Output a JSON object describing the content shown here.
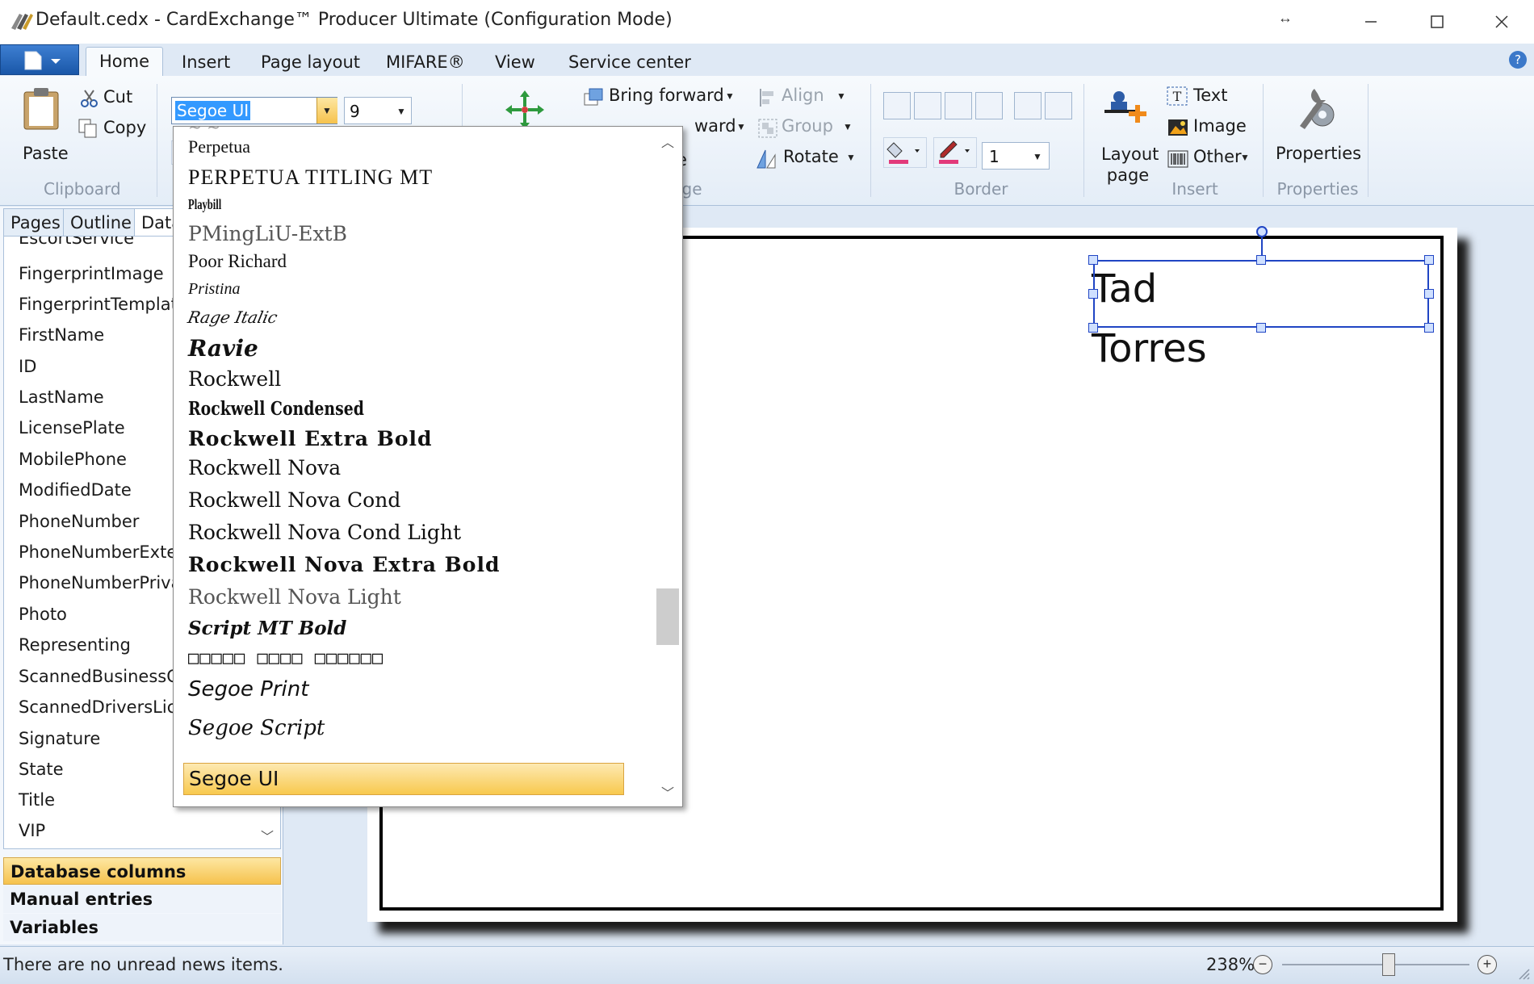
{
  "window": {
    "title": "Default.cedx - CardExchange™ Producer Ultimate (Configuration Mode)",
    "resize_glyph": "↔"
  },
  "ribbon_tabs": [
    "Home",
    "Insert",
    "Page layout",
    "MIFARE®",
    "View",
    "Service center"
  ],
  "ribbon": {
    "clipboard": {
      "paste": "Paste",
      "cut": "Cut",
      "copy": "Copy",
      "group": "Clipboard"
    },
    "font": {
      "family": "Segoe UI",
      "size": "9"
    },
    "arrange": {
      "bring_forward": "Bring forward",
      "send_backward_partial": "ward",
      "arrange_partial_e": "e",
      "group_partial_ge": "ge",
      "align": "Align",
      "group": "Group",
      "rotate": "Rotate"
    },
    "border": {
      "group": "Border",
      "line_width": "1"
    },
    "insert": {
      "layout_page": "Layout page",
      "text": "Text",
      "image": "Image",
      "other": "Other",
      "group": "Insert"
    },
    "properties": {
      "label": "Properties",
      "group": "Properties"
    }
  },
  "left_pane": {
    "tabs": [
      "Pages",
      "Outline",
      "Data"
    ],
    "fields": [
      "EscortService",
      "FingerprintImage",
      "FingerprintTemplate",
      "FirstName",
      "ID",
      "LastName",
      "LicensePlate",
      "MobilePhone",
      "ModifiedDate",
      "PhoneNumber",
      "PhoneNumberExtens",
      "PhoneNumberPrivate",
      "Photo",
      "Representing",
      "ScannedBusinessCard",
      "ScannedDriversLicen",
      "Signature",
      "State",
      "Title",
      "VIP"
    ],
    "sections": [
      "Database columns",
      "Manual entries",
      "Variables"
    ]
  },
  "font_list": [
    "Perpetua",
    "PERPETUA TITLING MT",
    "Playbill",
    "PMingLiU-ExtB",
    "Poor Richard",
    "Pristina",
    "Rage Italic",
    "Ravie",
    "Rockwell",
    "Rockwell Condensed",
    "Rockwell Extra Bold",
    "Rockwell Nova",
    "Rockwell Nova Cond",
    "Rockwell Nova Cond Light",
    "Rockwell Nova Extra Bold",
    "Rockwell Nova Light",
    "Script MT Bold",
    "□□□□□ □□□□ □□□□□□",
    "Segoe Print",
    "Segoe Script",
    "Segoe UI"
  ],
  "card": {
    "first_name": "Tad",
    "last_name": "Torres"
  },
  "status": {
    "message": "There are no unread news items.",
    "zoom": "238%",
    "zoom_level": 0.57
  },
  "colors": {
    "accent": "#f6c24d",
    "selection": "#2045c4",
    "file_button": "#1a57a8"
  }
}
